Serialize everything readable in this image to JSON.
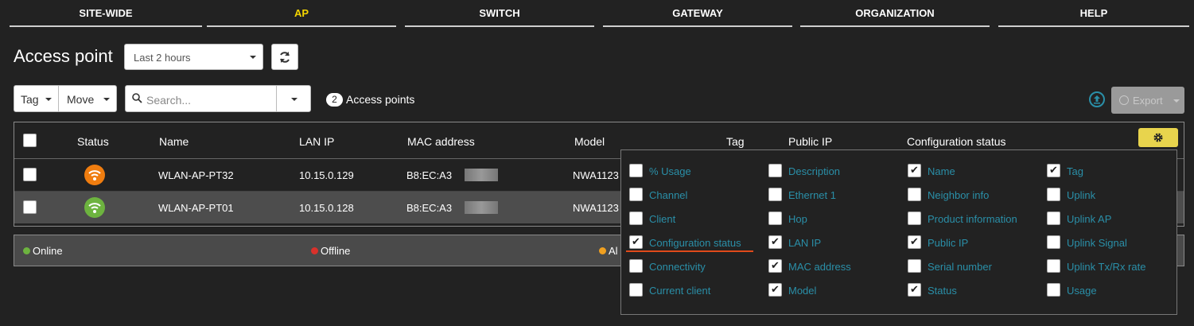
{
  "nav": {
    "tabs": [
      {
        "label": "SITE-WIDE",
        "active": false
      },
      {
        "label": "AP",
        "active": true
      },
      {
        "label": "SWITCH",
        "active": false
      },
      {
        "label": "GATEWAY",
        "active": false
      },
      {
        "label": "ORGANIZATION",
        "active": false
      },
      {
        "label": "HELP",
        "active": false
      }
    ]
  },
  "page": {
    "title": "Access point",
    "time_range": "Last 2 hours"
  },
  "toolbar": {
    "tag_label": "Tag",
    "move_label": "Move",
    "search_placeholder": "Search...",
    "count": "2",
    "count_label": "Access points",
    "export_label": "Export"
  },
  "table": {
    "columns": [
      "Status",
      "Name",
      "LAN IP",
      "MAC address",
      "Model",
      "Tag",
      "Public IP",
      "Configuration status"
    ],
    "rows": [
      {
        "status": "alert",
        "status_color": "#f07d0f",
        "name": "WLAN-AP-PT32",
        "lan_ip": "10.15.0.129",
        "mac": "B8:EC:A3",
        "model": "NWA1123"
      },
      {
        "status": "online",
        "status_color": "#6db33f",
        "name": "WLAN-AP-PT01",
        "lan_ip": "10.15.0.128",
        "mac": "B8:EC:A3",
        "model": "NWA1123"
      }
    ]
  },
  "legend": {
    "online": "Online",
    "offline": "Offline",
    "alert": "Al",
    "colors": {
      "online": "#6db33f",
      "offline": "#d9312b",
      "alert": "#f0a020"
    }
  },
  "column_picker": {
    "columns": [
      [
        {
          "label": "% Usage",
          "checked": false
        },
        {
          "label": "Channel",
          "checked": false
        },
        {
          "label": "Client",
          "checked": false
        },
        {
          "label": "Configuration status",
          "checked": true
        },
        {
          "label": "Connectivity",
          "checked": false
        },
        {
          "label": "Current client",
          "checked": false
        }
      ],
      [
        {
          "label": "Description",
          "checked": false
        },
        {
          "label": "Ethernet 1",
          "checked": false
        },
        {
          "label": "Hop",
          "checked": false
        },
        {
          "label": "LAN IP",
          "checked": true
        },
        {
          "label": "MAC address",
          "checked": true
        },
        {
          "label": "Model",
          "checked": true
        }
      ],
      [
        {
          "label": "Name",
          "checked": true
        },
        {
          "label": "Neighbor info",
          "checked": false
        },
        {
          "label": "Product information",
          "checked": false
        },
        {
          "label": "Public IP",
          "checked": true
        },
        {
          "label": "Serial number",
          "checked": false
        },
        {
          "label": "Status",
          "checked": true
        }
      ],
      [
        {
          "label": "Tag",
          "checked": true
        },
        {
          "label": "Uplink",
          "checked": false
        },
        {
          "label": "Uplink AP",
          "checked": false
        },
        {
          "label": "Uplink Signal",
          "checked": false
        },
        {
          "label": "Uplink Tx/Rx rate",
          "checked": false
        },
        {
          "label": "Usage",
          "checked": false
        }
      ]
    ]
  },
  "icons": {
    "refresh": "refresh-icon",
    "search": "search-icon",
    "upload": "upload-icon",
    "gear": "gear-icon",
    "wifi": "wifi-icon"
  }
}
